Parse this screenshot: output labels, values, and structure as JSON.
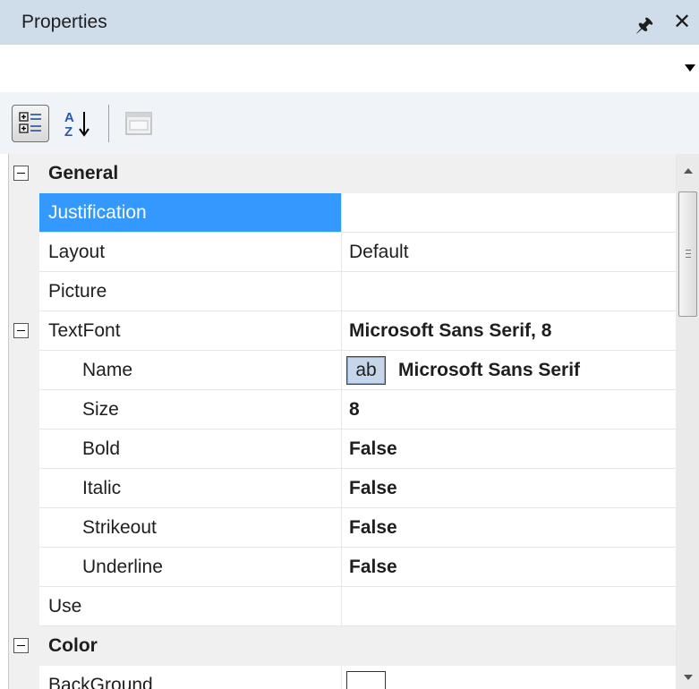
{
  "title": "Properties",
  "object_selector": {
    "value": ""
  },
  "toolbar": {
    "categorized_icon": "categorized-icon",
    "alphabetical_icon": "alphabetical-sort-icon",
    "property_pages_icon": "property-pages-icon"
  },
  "rows": [
    {
      "name": "General",
      "value": "",
      "kind": "category"
    },
    {
      "name": "Justification",
      "value": "",
      "kind": "selected"
    },
    {
      "name": "Layout",
      "value": "Default",
      "kind": "property"
    },
    {
      "name": "Picture",
      "value": "",
      "kind": "property"
    },
    {
      "name": "TextFont",
      "value": "Microsoft Sans Serif, 8",
      "kind": "expanded"
    },
    {
      "name": "Name",
      "value": "Microsoft Sans Serif",
      "preview": "ab",
      "kind": "font-name"
    },
    {
      "name": "Size",
      "value": "8",
      "kind": "sub"
    },
    {
      "name": "Bold",
      "value": "False",
      "kind": "sub"
    },
    {
      "name": "Italic",
      "value": "False",
      "kind": "sub"
    },
    {
      "name": "Strikeout",
      "value": "False",
      "kind": "sub"
    },
    {
      "name": "Underline",
      "value": "False",
      "kind": "sub"
    },
    {
      "name": "Use",
      "value": "",
      "kind": "property"
    },
    {
      "name": "Color",
      "value": "",
      "kind": "category"
    },
    {
      "name": "BackGround",
      "value": "",
      "kind": "color"
    }
  ],
  "colors": {
    "titlebar": "#cfdcea",
    "selection": "#3399ff",
    "toolbar": "#f0f3f7"
  }
}
